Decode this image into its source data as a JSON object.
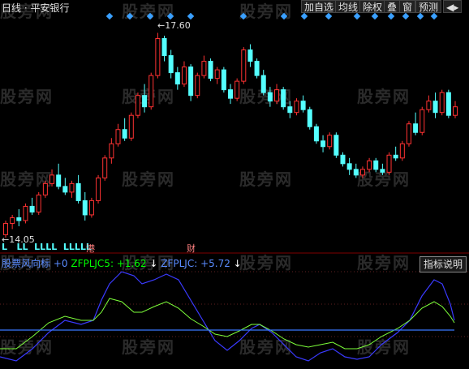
{
  "window": {
    "title": "日线 · 平安银行"
  },
  "toolbar": {
    "buttons": [
      {
        "label": "加自选"
      },
      {
        "label": "均线"
      },
      {
        "label": "除权"
      },
      {
        "label": "叠"
      },
      {
        "label": "窗"
      },
      {
        "label": "预测"
      },
      {
        "label": "◀▸"
      }
    ]
  },
  "price_chart": {
    "high_label": "17.60",
    "low_label": "14.05",
    "marker_gang": "港",
    "marker_cai": "财",
    "up_color": "#ff3232",
    "down_color": "#54ffff",
    "signal_text": "L   LL  LLLL  LLLLL"
  },
  "indicator": {
    "label_parts": [
      {
        "text": "股票风向标",
        "color": "#5a8cff"
      },
      {
        "text": " +0 ",
        "color": "#5a8cff"
      },
      {
        "text": "ZFPLJC5: +1.62",
        "color": "#00ff00"
      },
      {
        "text": " ↓ ",
        "color": "#ffffff"
      },
      {
        "text": " ZFPLJC: +5.72",
        "color": "#5a8cff"
      },
      {
        "text": " ↓",
        "color": "#ffffff"
      }
    ],
    "button_label": "指标说明",
    "line1_color": "#3a3aff",
    "line2_color": "#7dff3a",
    "baseline_color": "#3a78ff"
  },
  "watermark": "股旁网",
  "chart_data": {
    "type": "candlestick",
    "title": "",
    "annotations": [
      "17.60",
      "14.05"
    ],
    "candles": [
      [
        14.05,
        14.3,
        14.0,
        14.25
      ],
      [
        14.25,
        14.4,
        14.15,
        14.35
      ],
      [
        14.35,
        14.5,
        14.2,
        14.3
      ],
      [
        14.3,
        14.6,
        14.25,
        14.55
      ],
      [
        14.55,
        14.7,
        14.4,
        14.45
      ],
      [
        14.45,
        14.8,
        14.4,
        14.75
      ],
      [
        14.75,
        15.0,
        14.7,
        14.95
      ],
      [
        14.95,
        15.2,
        14.9,
        15.1
      ],
      [
        15.1,
        15.3,
        14.85,
        14.9
      ],
      [
        14.9,
        15.05,
        14.75,
        14.8
      ],
      [
        14.8,
        15.0,
        14.7,
        14.95
      ],
      [
        14.95,
        15.1,
        14.6,
        14.65
      ],
      [
        14.65,
        14.8,
        14.3,
        14.4
      ],
      [
        14.4,
        14.7,
        14.35,
        14.65
      ],
      [
        14.65,
        15.1,
        14.6,
        15.05
      ],
      [
        15.05,
        15.45,
        15.0,
        15.4
      ],
      [
        15.4,
        15.75,
        15.3,
        15.65
      ],
      [
        15.65,
        16.0,
        15.6,
        15.9
      ],
      [
        15.9,
        16.1,
        15.7,
        15.75
      ],
      [
        15.75,
        16.2,
        15.7,
        16.15
      ],
      [
        16.15,
        16.55,
        16.1,
        16.5
      ],
      [
        16.5,
        16.7,
        16.2,
        16.3
      ],
      [
        16.3,
        16.9,
        16.25,
        16.85
      ],
      [
        16.85,
        17.6,
        16.8,
        17.5
      ],
      [
        17.5,
        17.55,
        17.1,
        17.2
      ],
      [
        17.2,
        17.3,
        16.8,
        16.9
      ],
      [
        16.9,
        17.0,
        16.6,
        16.7
      ],
      [
        16.7,
        17.1,
        16.65,
        17.0
      ],
      [
        17.0,
        17.05,
        16.4,
        16.5
      ],
      [
        16.5,
        16.9,
        16.45,
        16.85
      ],
      [
        16.85,
        17.2,
        16.8,
        17.1
      ],
      [
        17.1,
        17.15,
        16.75,
        16.8
      ],
      [
        16.8,
        17.0,
        16.7,
        16.95
      ],
      [
        16.95,
        17.0,
        16.55,
        16.6
      ],
      [
        16.6,
        16.7,
        16.35,
        16.45
      ],
      [
        16.45,
        16.8,
        16.4,
        16.75
      ],
      [
        16.75,
        17.35,
        16.7,
        17.3
      ],
      [
        17.3,
        17.4,
        17.0,
        17.1
      ],
      [
        17.1,
        17.15,
        16.8,
        16.85
      ],
      [
        16.85,
        16.95,
        16.5,
        16.55
      ],
      [
        16.55,
        16.65,
        16.3,
        16.4
      ],
      [
        16.4,
        16.7,
        16.35,
        16.6
      ],
      [
        16.6,
        16.65,
        16.25,
        16.3
      ],
      [
        16.3,
        16.4,
        16.1,
        16.2
      ],
      [
        16.2,
        16.45,
        16.15,
        16.4
      ],
      [
        16.4,
        16.5,
        16.2,
        16.25
      ],
      [
        16.25,
        16.3,
        15.9,
        15.95
      ],
      [
        15.95,
        16.0,
        15.65,
        15.7
      ],
      [
        15.7,
        15.8,
        15.5,
        15.6
      ],
      [
        15.6,
        15.85,
        15.55,
        15.8
      ],
      [
        15.8,
        15.85,
        15.4,
        15.45
      ],
      [
        15.45,
        15.5,
        15.25,
        15.3
      ],
      [
        15.3,
        15.4,
        15.1,
        15.2
      ],
      [
        15.2,
        15.3,
        15.05,
        15.1
      ],
      [
        15.1,
        15.25,
        15.05,
        15.2
      ],
      [
        15.2,
        15.4,
        15.15,
        15.35
      ],
      [
        15.35,
        15.4,
        15.15,
        15.2
      ],
      [
        15.2,
        15.3,
        15.1,
        15.15
      ],
      [
        15.15,
        15.5,
        15.1,
        15.45
      ],
      [
        15.45,
        15.6,
        15.35,
        15.4
      ],
      [
        15.4,
        15.7,
        15.35,
        15.65
      ],
      [
        15.65,
        16.05,
        15.6,
        16.0
      ],
      [
        16.0,
        16.2,
        15.8,
        15.85
      ],
      [
        15.85,
        16.3,
        15.8,
        16.25
      ],
      [
        16.25,
        16.5,
        16.2,
        16.4
      ],
      [
        16.4,
        16.55,
        16.1,
        16.2
      ],
      [
        16.2,
        16.6,
        16.15,
        16.55
      ],
      [
        16.55,
        16.6,
        16.1,
        16.15
      ],
      [
        16.15,
        16.4,
        16.1,
        16.3
      ]
    ]
  }
}
